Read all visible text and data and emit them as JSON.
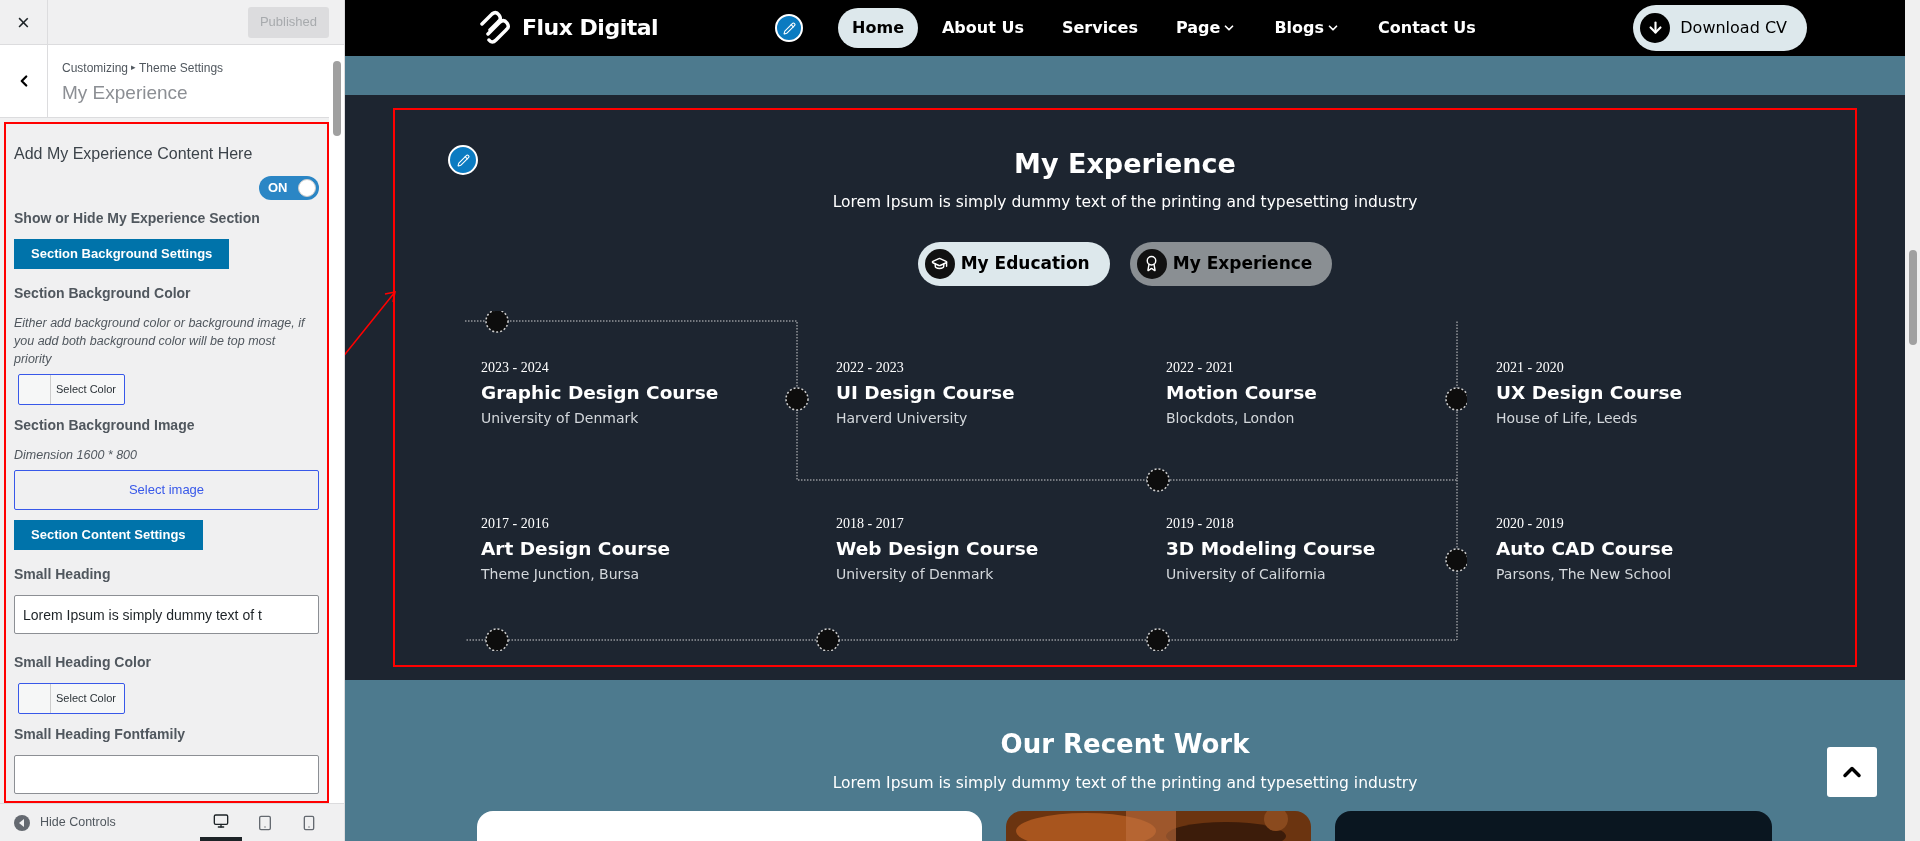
{
  "customizer": {
    "close": "×",
    "publish_button": {
      "label": "Published",
      "disabled": true
    },
    "breadcrumb": [
      "Customizing",
      "Theme Settings"
    ],
    "breadcrumb_separator": "▸",
    "panel_title": "My Experience",
    "controls": [
      {
        "kind": "heading",
        "text": "Add My Experience Content Here"
      },
      {
        "kind": "toggle",
        "on": true,
        "text": "ON"
      },
      {
        "kind": "label",
        "text": "Show or Hide My Experience Section"
      },
      {
        "kind": "section_button",
        "text": "Section Background Settings"
      },
      {
        "kind": "label",
        "text": "Section Background Color"
      },
      {
        "kind": "description",
        "text": "Either add background color or background image, if you add both background color will be top most priority"
      },
      {
        "kind": "color_picker",
        "text": "Select Color"
      },
      {
        "kind": "label",
        "text": "Section Background Image"
      },
      {
        "kind": "description",
        "text": "Dimension 1600 * 800"
      },
      {
        "kind": "image_picker",
        "text": "Select image"
      },
      {
        "kind": "section_button",
        "text": "Section Content Settings"
      },
      {
        "kind": "label",
        "text": "Small Heading"
      },
      {
        "kind": "text_input",
        "text": "Lorem Ipsum is simply dummy text of t"
      },
      {
        "kind": "label",
        "text": "Small Heading Color"
      },
      {
        "kind": "color_picker",
        "text": "Select Color"
      },
      {
        "kind": "label",
        "text": "Small Heading Fontfamily"
      },
      {
        "kind": "text_input"
      }
    ],
    "footer": {
      "hide_controls": "Hide Controls",
      "devices": [
        {
          "kind": "desktop",
          "selected": true
        },
        {
          "kind": "tablet",
          "selected": false
        },
        {
          "kind": "mobile",
          "selected": false
        }
      ]
    }
  },
  "preview": {
    "nav": {
      "logo": "Flux Digital",
      "links": [
        {
          "label": "Home",
          "selected": true,
          "dropdown": false
        },
        {
          "label": "About Us",
          "selected": false,
          "dropdown": false
        },
        {
          "label": "Services",
          "selected": false,
          "dropdown": false
        },
        {
          "label": "Page",
          "selected": false,
          "dropdown": true
        },
        {
          "label": "Blogs",
          "selected": false,
          "dropdown": true
        },
        {
          "label": "Contact Us",
          "selected": false,
          "dropdown": false
        }
      ],
      "download_button": "Download CV"
    },
    "section": {
      "title": "My Experience",
      "subtitle": "Lorem Ipsum is simply dummy text of the printing and typesetting industry",
      "tabs": [
        {
          "label": "My Education",
          "kind": "education",
          "selected": true
        },
        {
          "label": "My Experience",
          "kind": "experience",
          "selected": false
        }
      ],
      "timeline": [
        {
          "date": "2023 - 2024",
          "title": "Graphic Design Course",
          "place": "University of Denmark"
        },
        {
          "date": "2022 - 2023",
          "title": "UI Design Course",
          "place": "Harverd University"
        },
        {
          "date": "2022 - 2021",
          "title": "Motion Course",
          "place": "Blockdots, London"
        },
        {
          "date": "2021 - 2020",
          "title": "UX Design Course",
          "place": "House of Life, Leeds"
        },
        {
          "date": "2017 - 2016",
          "title": "Art Design Course",
          "place": "Theme Junction, Bursa"
        },
        {
          "date": "2018 - 2017",
          "title": "Web Design Course",
          "place": "University of Denmark"
        },
        {
          "date": "2019 - 2018",
          "title": "3D Modeling Course",
          "place": "University of California"
        },
        {
          "date": "2020 - 2019",
          "title": "Auto CAD Course",
          "place": "Parsons, The New School"
        }
      ]
    },
    "next_section": {
      "title": "Our Recent Work",
      "subtitle": "Lorem Ipsum is simply dummy text of the printing and typesetting industry"
    }
  }
}
